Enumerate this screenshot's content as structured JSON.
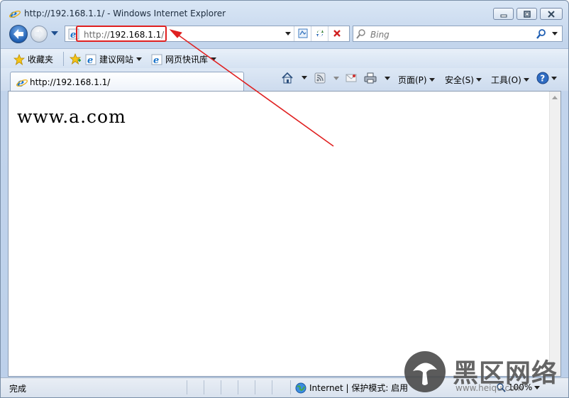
{
  "window": {
    "title": "http://192.168.1.1/ - Windows Internet Explorer"
  },
  "address_bar": {
    "prefix": "http://",
    "host": "192.168.1.1",
    "suffix": "/"
  },
  "search": {
    "placeholder": "Bing"
  },
  "favorites_bar": {
    "favorites_label": "收藏夹",
    "suggested_sites_label": "建议网站",
    "web_slice_gallery_label": "网页快讯库"
  },
  "tab": {
    "label": "http://192.168.1.1/"
  },
  "command_bar": {
    "page_label": "页面(P)",
    "safety_label": "安全(S)",
    "tools_label": "工具(O)"
  },
  "page": {
    "body_text": "www.a.com"
  },
  "status_bar": {
    "status_text": "完成",
    "zone_text": "Internet | 保护模式: 启用",
    "zoom_text": "100%"
  },
  "watermark": {
    "text": "黑区网络",
    "subtext": "www.heiqu.com"
  },
  "colors": {
    "annotation_red": "#e02020",
    "frame_blue": "#c3d5ec"
  },
  "icons": {
    "ie_logo": "ie-logo-icon",
    "back": "back-arrow-icon",
    "forward": "forward-arrow-icon",
    "refresh": "refresh-icon",
    "stop": "stop-icon",
    "compat": "compatibility-view-icon",
    "search": "search-icon",
    "home": "home-icon",
    "feeds": "rss-feed-icon",
    "mail": "mail-icon",
    "print": "print-icon",
    "help": "help-icon",
    "globe": "globe-icon"
  }
}
